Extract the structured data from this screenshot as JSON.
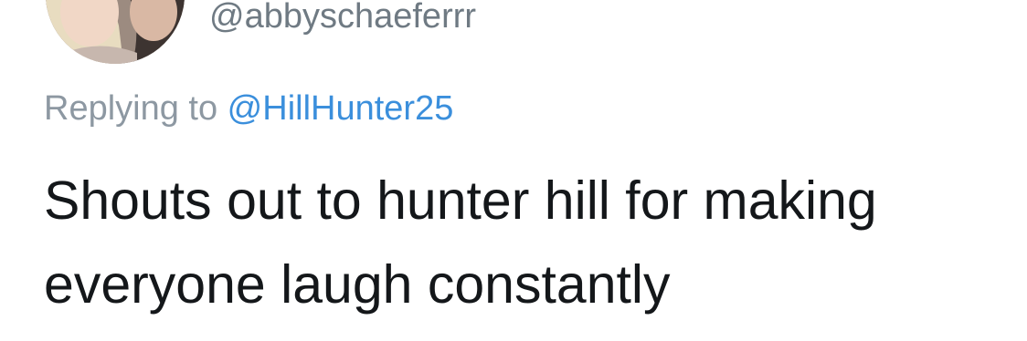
{
  "tweet": {
    "handle": "@abbyschaeferrr",
    "reply_prefix": "Replying to ",
    "reply_to": "@HillHunter25",
    "text_lines": [
      "Shouts out to hunter hill for making",
      "everyone laugh constantly"
    ]
  },
  "colors": {
    "handle": "#6f7a83",
    "reply_prefix": "#8d98a2",
    "link": "#3b8fdc",
    "text": "#14171a"
  }
}
